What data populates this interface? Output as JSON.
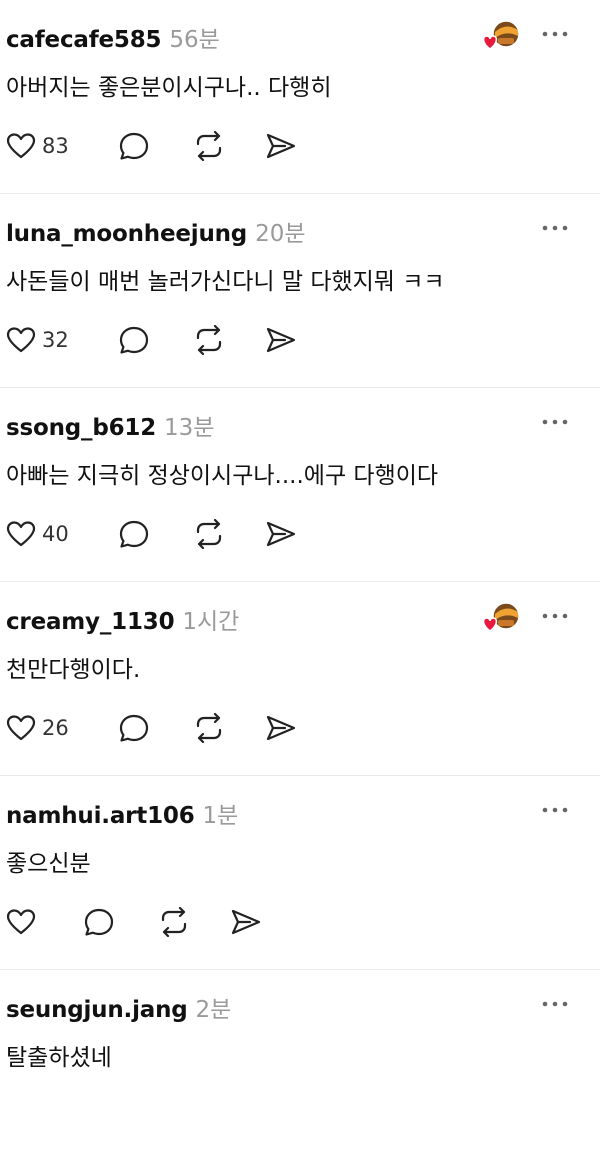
{
  "comments": [
    {
      "username": "cafecafe585",
      "time": "56분",
      "text": "아버지는 좋은분이시구나.. 다행히",
      "likes": "83",
      "has_avatar_badge": true
    },
    {
      "username": "luna_moonheejung",
      "time": "20분",
      "text": "사돈들이 매번 놀러가신다니 말 다했지뭐 ㅋㅋ",
      "likes": "32",
      "has_avatar_badge": false
    },
    {
      "username": "ssong_b612",
      "time": "13분",
      "text": "아빠는 지극히 정상이시구나....에구 다행이다",
      "likes": "40",
      "has_avatar_badge": false
    },
    {
      "username": "creamy_1130",
      "time": "1시간",
      "text": "천만다행이다.",
      "likes": "26",
      "has_avatar_badge": true
    },
    {
      "username": "namhui.art106",
      "time": "1분",
      "text": "좋으신분",
      "likes": "",
      "has_avatar_badge": false
    },
    {
      "username": "seungjun.jang",
      "time": "2분",
      "text": "탈출하셨네",
      "likes": "",
      "has_avatar_badge": false
    }
  ],
  "icons": {
    "like": "heart-outline-icon",
    "reply": "speech-bubble-icon",
    "repost": "repost-arrows-icon",
    "share": "send-arrow-icon",
    "more": "more-dots-icon",
    "avatar": "liked-by-author-avatar-icon"
  },
  "colors": {
    "text": "#111111",
    "muted": "#9a9a9a",
    "divider": "#e9e9e9",
    "heart_badge": "#e8193c"
  }
}
